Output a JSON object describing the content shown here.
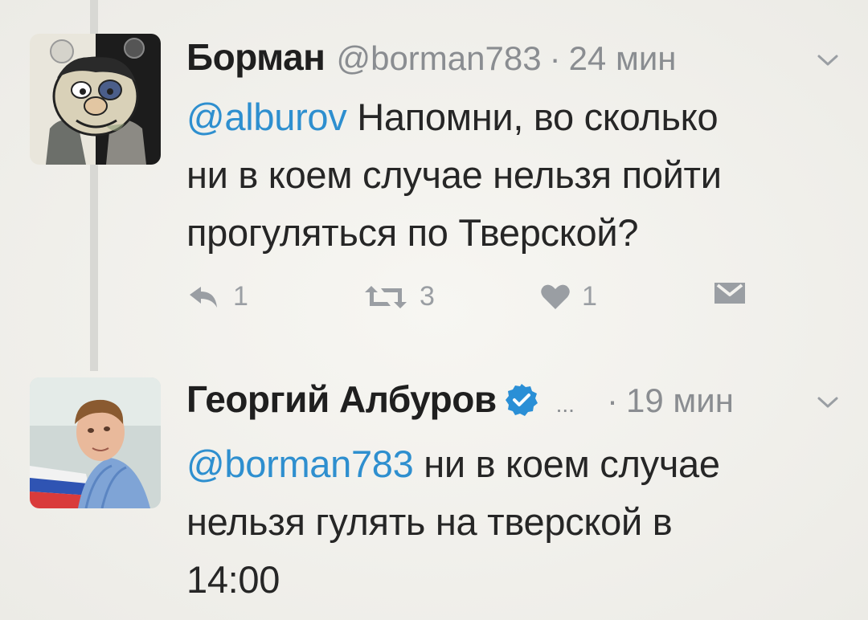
{
  "tweet1": {
    "name": "Борман",
    "handle": "@borman783",
    "separator": "·",
    "time": "24 мин",
    "mention": "@alburov",
    "text_line1": " Напомни, во сколько",
    "text_line2": "ни в коем случае нельзя пойти",
    "text_line3": "прогуляться по Тверской?",
    "replies": "1",
    "retweets": "3",
    "likes": "1"
  },
  "tweet2": {
    "name": "Георгий Албуров",
    "more": "...",
    "separator": "·",
    "time": "19 мин",
    "mention": "@borman783",
    "text_line1": " ни в коем случае",
    "text_line2": "нельзя гулять на тверской в",
    "text_line3": "14:00"
  },
  "colors": {
    "accent": "#2e8fcf",
    "verified": "#2a8fd6",
    "muted": "#8a8d91",
    "thread_line": "#d8d8d4"
  },
  "icons": {
    "reply": "reply-icon",
    "retweet": "retweet-icon",
    "like": "heart-icon",
    "dm": "envelope-icon",
    "menu": "chevron-down-icon",
    "verified": "verified-badge-icon"
  }
}
